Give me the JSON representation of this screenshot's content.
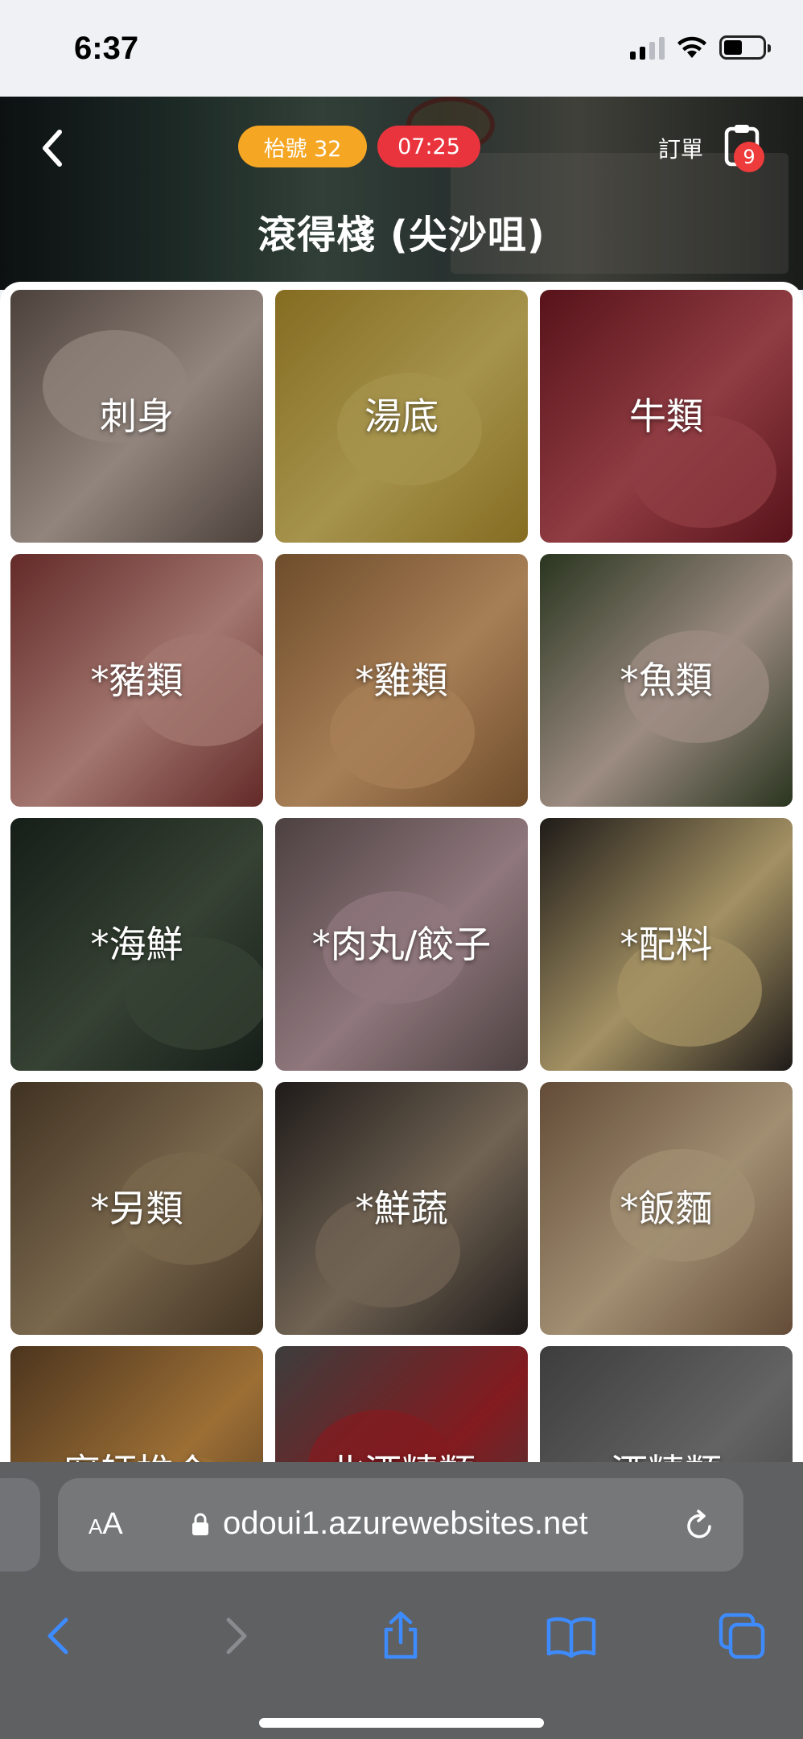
{
  "status_bar": {
    "time": "6:37"
  },
  "header": {
    "table_label": "枱號 32",
    "timer": "07:25",
    "order_label": "訂單",
    "order_count": "9",
    "store_name": "滾得棧 (尖沙咀)",
    "icons": {
      "back": "chevron-left-icon",
      "order": "clipboard-icon"
    }
  },
  "menu": {
    "categories": [
      {
        "label": "刺身",
        "color_a": "#6a5a52",
        "color_b": "#c9b8ad"
      },
      {
        "label": "湯底",
        "color_a": "#b8962e",
        "color_b": "#e6cc6a"
      },
      {
        "label": "牛類",
        "color_a": "#7a1a24",
        "color_b": "#c8545d"
      },
      {
        "label": "*豬類",
        "color_a": "#8a3b38",
        "color_b": "#e2a49a"
      },
      {
        "label": "*雞類",
        "color_a": "#9a6a3c",
        "color_b": "#e8b078"
      },
      {
        "label": "*魚類",
        "color_a": "#3a4a2c",
        "color_b": "#d9c2b4"
      },
      {
        "label": "*海鮮",
        "color_a": "#1f2a22",
        "color_b": "#4b5c48"
      },
      {
        "label": "*肉丸/餃子",
        "color_a": "#6b5a5a",
        "color_b": "#c7a6ad"
      },
      {
        "label": "*配料",
        "color_a": "#2b2622",
        "color_b": "#e3c98a"
      },
      {
        "label": "*另類",
        "color_a": "#5a4630",
        "color_b": "#a9906b"
      },
      {
        "label": "*鮮蔬",
        "color_a": "#2c2624",
        "color_b": "#9c8a74"
      },
      {
        "label": "*飯麵",
        "color_a": "#8a6a4e",
        "color_b": "#e0c69e"
      },
      {
        "label": "廚師推介",
        "color_a": "#6a4a2a",
        "color_b": "#d99a4a"
      },
      {
        "label": "北酒精類",
        "color_a": "#555",
        "color_b": "#b5262c"
      },
      {
        "label": "酒精類",
        "color_a": "#555",
        "color_b": "#8a8a8a"
      }
    ]
  },
  "browser": {
    "text_size_label": "AA",
    "url": "odoui1.azurewebsites.net",
    "icons": [
      "back-icon",
      "forward-icon",
      "share-icon",
      "bookmarks-icon",
      "tabs-icon"
    ]
  }
}
